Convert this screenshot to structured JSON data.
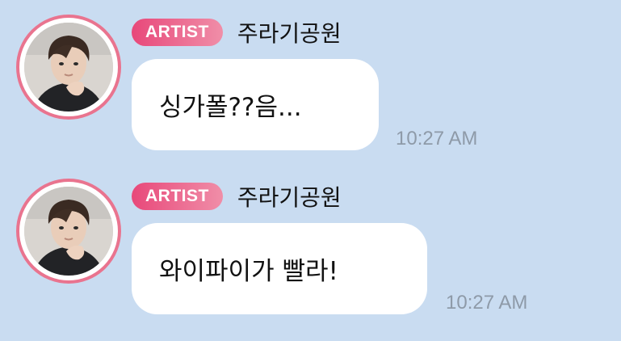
{
  "messages": [
    {
      "badge": "ARTIST",
      "sender": "주라기공원",
      "text": "싱가폴??음...",
      "time": "10:27 AM"
    },
    {
      "badge": "ARTIST",
      "sender": "주라기공원",
      "text": "와이파이가 빨라!",
      "time": "10:27 AM"
    }
  ],
  "colors": {
    "background": "#c9dcf1",
    "bubble": "#ffffff",
    "badge_start": "#e8487a",
    "badge_end": "#f08ea8",
    "avatar_ring": "#e9748f",
    "timestamp": "#8e9aa8"
  }
}
